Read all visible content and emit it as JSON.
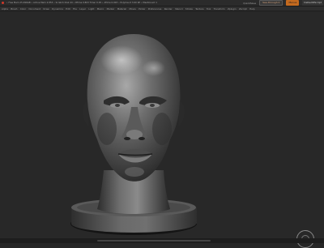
{
  "titlebar": {
    "info": "• Free Mem 25.496GB • Active Mem 2.853 • Scratch Disk 44 • RTime 0.803 Timer 0.05 • ATime 0.003 • PolyCount 3.00 KP • MeshCount 1",
    "quicksave": "QuickSave",
    "seethrough": "See-through 0",
    "menus": "Menus",
    "default_script": "DefaultZScript"
  },
  "menubar": {
    "items": [
      "Alpha",
      "Brush",
      "Color",
      "Document",
      "Draw",
      "Dynamics",
      "Edit",
      "File",
      "Layer",
      "Light",
      "Macro",
      "Marker",
      "Material",
      "Movie",
      "Picker",
      "Preferences",
      "Render",
      "Stencil",
      "Stroke",
      "Texture",
      "Tool",
      "Transform",
      "Zplugin",
      "Zscript",
      "Help"
    ]
  },
  "viewport": {
    "model": "sculpted-head-bust"
  },
  "colors": {
    "background": "#282828",
    "accent": "#c46a1f"
  }
}
